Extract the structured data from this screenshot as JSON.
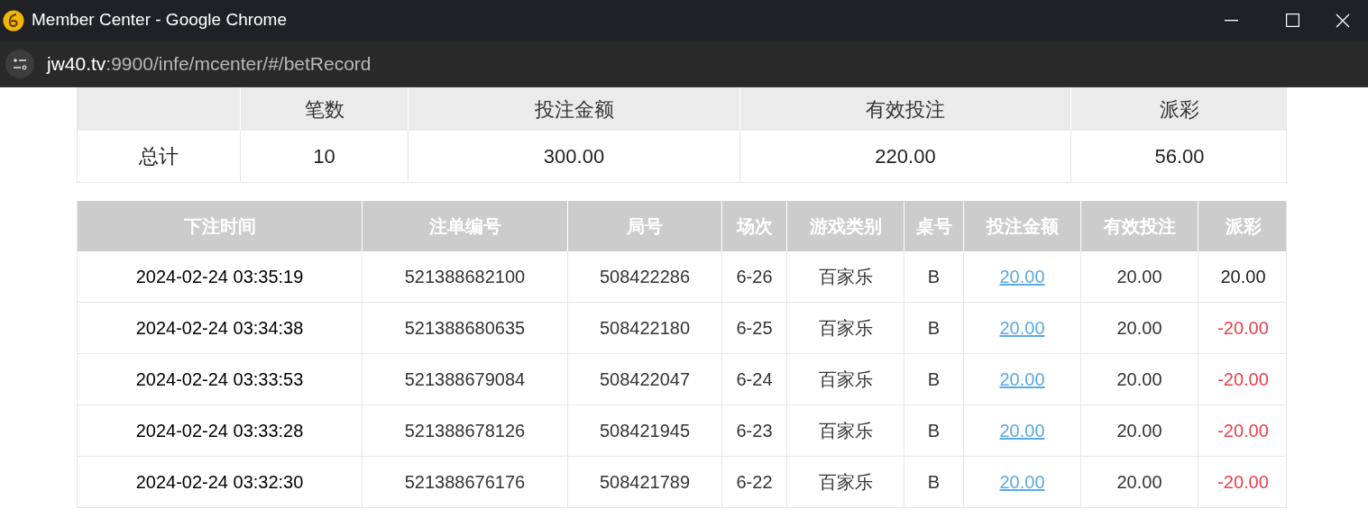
{
  "window": {
    "title": "Member Center - Google Chrome"
  },
  "address_bar": {
    "url_host": "jw40.tv",
    "url_rest": ":9900/infe/mcenter/#/betRecord"
  },
  "summary": {
    "columns": [
      "",
      "笔数",
      "投注金额",
      "有效投注",
      "派彩"
    ],
    "row": [
      "总计",
      "10",
      "300.00",
      "220.00",
      "56.00"
    ]
  },
  "records": {
    "columns": [
      "下注时间",
      "注单编号",
      "局号",
      "场次",
      "游戏类别",
      "桌号",
      "投注金额",
      "有效投注",
      "派彩"
    ],
    "rows": [
      {
        "time": "2024-02-24 03:35:19",
        "bet_no": "521388682100",
        "round_no": "508422286",
        "session": "6-26",
        "game": "百家乐",
        "table": "B",
        "amount": "20.00",
        "valid": "20.00",
        "payout": "20.00",
        "negative": false
      },
      {
        "time": "2024-02-24 03:34:38",
        "bet_no": "521388680635",
        "round_no": "508422180",
        "session": "6-25",
        "game": "百家乐",
        "table": "B",
        "amount": "20.00",
        "valid": "20.00",
        "payout": "-20.00",
        "negative": true
      },
      {
        "time": "2024-02-24 03:33:53",
        "bet_no": "521388679084",
        "round_no": "508422047",
        "session": "6-24",
        "game": "百家乐",
        "table": "B",
        "amount": "20.00",
        "valid": "20.00",
        "payout": "-20.00",
        "negative": true
      },
      {
        "time": "2024-02-24 03:33:28",
        "bet_no": "521388678126",
        "round_no": "508421945",
        "session": "6-23",
        "game": "百家乐",
        "table": "B",
        "amount": "20.00",
        "valid": "20.00",
        "payout": "-20.00",
        "negative": true
      },
      {
        "time": "2024-02-24 03:32:30",
        "bet_no": "521388676176",
        "round_no": "508421789",
        "session": "6-22",
        "game": "百家乐",
        "table": "B",
        "amount": "20.00",
        "valid": "20.00",
        "payout": "-20.00",
        "negative": true
      }
    ]
  }
}
